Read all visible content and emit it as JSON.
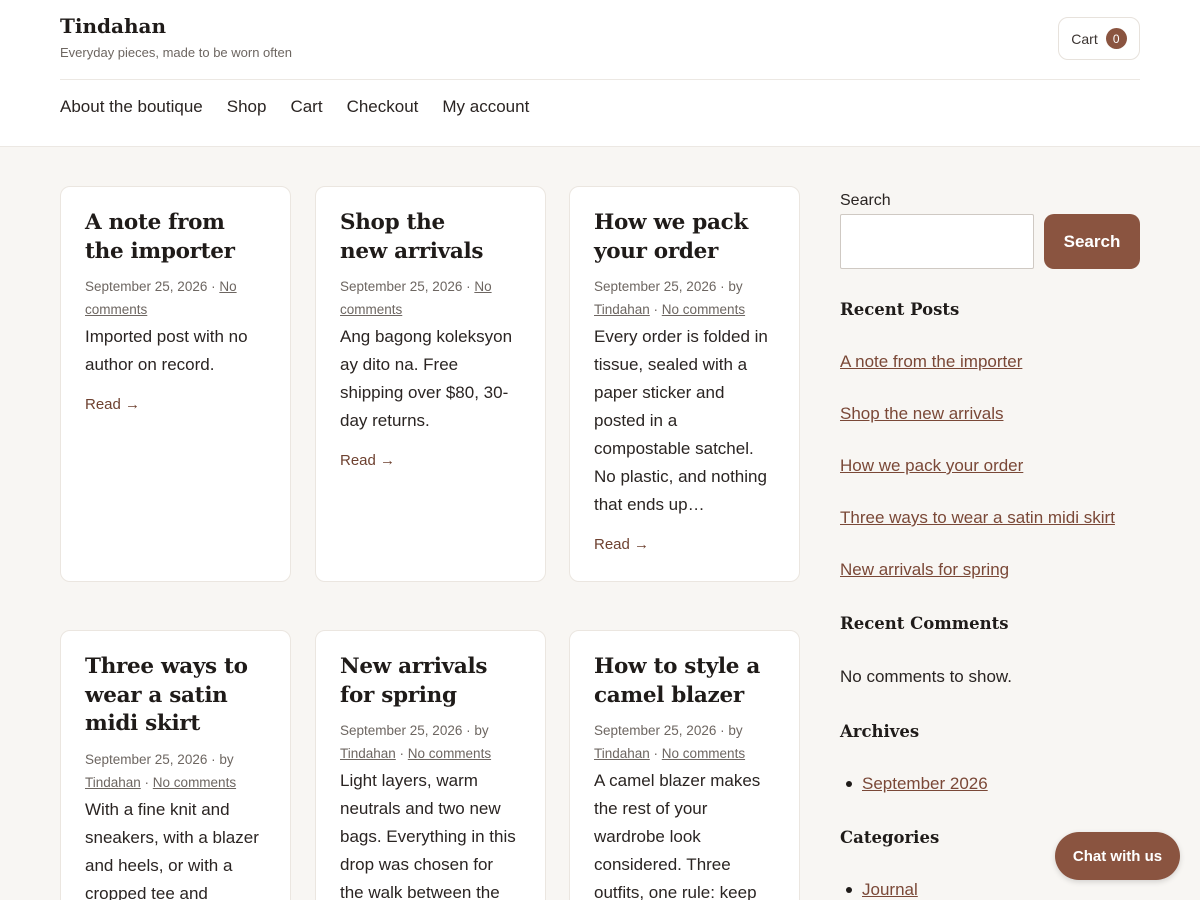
{
  "header": {
    "site_title": "Tindahan",
    "tagline": "Everyday pieces, made to be worn often",
    "cart_label": "Cart",
    "cart_count": "0",
    "nav": [
      "About the boutique",
      "Shop",
      "Cart",
      "Checkout",
      "My account"
    ]
  },
  "posts": [
    {
      "title_line1": "A note from",
      "title_line2": "the importer",
      "title_line3": "",
      "date": "September 25, 2026",
      "sep": " · ",
      "by": "",
      "author": "",
      "author_sep": "",
      "comments": "No comments",
      "excerpt": "Imported post with no author on record.",
      "read": "Read →"
    },
    {
      "title_line1": "Shop the",
      "title_line2": "new arrivals",
      "title_line3": "",
      "date": "September 25, 2026",
      "sep": " · ",
      "by": "",
      "author": "",
      "author_sep": "",
      "comments": "No comments",
      "excerpt": "Ang bagong koleksyon ay dito na. Free shipping over $80, 30-day returns.",
      "read": "Read →"
    },
    {
      "title_line1": "How we pack",
      "title_line2": "your order",
      "title_line3": "",
      "date": "September 25, 2026",
      "sep": " · ",
      "by": "by",
      "author": "Tindahan",
      "author_sep": " · ",
      "comments": "No comments",
      "excerpt": "Every order is folded in tissue, sealed with a paper sticker and posted in a compostable satchel. No plastic, and nothing that ends up…",
      "read": "Read →"
    },
    {
      "title_line1": "Three ways to",
      "title_line2": "wear a satin",
      "title_line3": "midi skirt",
      "date": "September 25, 2026",
      "sep": " · ",
      "by": "by",
      "author": "Tindahan",
      "author_sep": " · ",
      "comments": "No comments",
      "excerpt": "With a fine knit and sneakers, with a blazer and heels, or with a cropped tee and",
      "read": ""
    },
    {
      "title_line1": "New arrivals",
      "title_line2": "for spring",
      "title_line3": "",
      "date": "September 25, 2026",
      "sep": " · ",
      "by": "by",
      "author": "Tindahan",
      "author_sep": " · ",
      "comments": "No comments",
      "excerpt": "Light layers, warm neutrals and two new bags. Everything in this drop was chosen for the walk between the train",
      "read": ""
    },
    {
      "title_line1": "How to style a",
      "title_line2": "camel blazer",
      "title_line3": "",
      "date": "September 25, 2026",
      "sep": " · ",
      "by": "by",
      "author": "Tindahan",
      "author_sep": " · ",
      "comments": "No comments",
      "excerpt": "A camel blazer makes the rest of your wardrobe look considered. Three outfits, one rule: keep",
      "read": ""
    }
  ],
  "sidebar": {
    "search_label": "Search",
    "search_value": "",
    "search_button": "Search",
    "recent_posts_heading": "Recent Posts",
    "recent_posts": [
      "A note from the importer",
      "Shop the new arrivals",
      "How we pack your order",
      "Three ways to wear a satin midi skirt",
      "New arrivals for spring"
    ],
    "recent_comments_heading": "Recent Comments",
    "recent_comments_text": "No comments to show.",
    "archives_heading": "Archives",
    "archives": [
      "September 2026"
    ],
    "categories_heading": "Categories",
    "categories": [
      "Journal"
    ]
  },
  "chat": {
    "label": "Chat with us"
  },
  "colors": {
    "accent": "#8a5440",
    "link": "#7a4837",
    "background": "#f8f6f3"
  }
}
